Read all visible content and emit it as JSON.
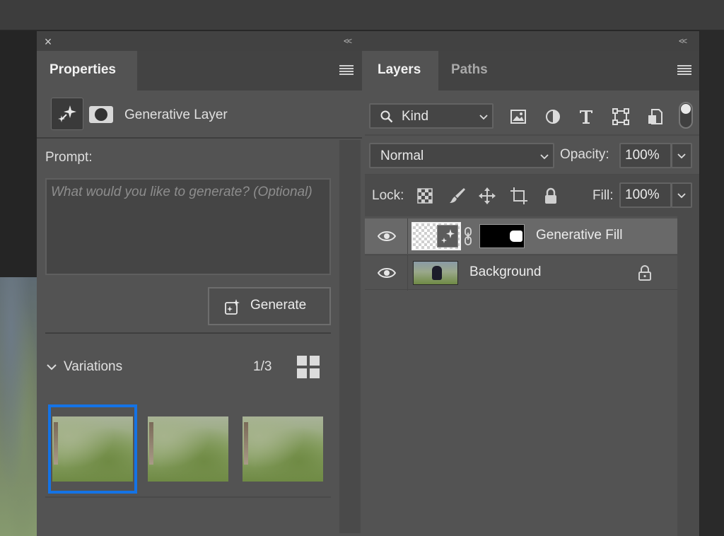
{
  "properties_panel": {
    "tab_label": "Properties",
    "layer_type_title": "Generative Layer",
    "prompt_label": "Prompt:",
    "prompt_placeholder": "What would you like to generate? (Optional)",
    "prompt_value": "",
    "generate_label": "Generate",
    "variations_label": "Variations",
    "variations_count": "1/3",
    "selected_variation": 1,
    "variation_count_total": 3
  },
  "layers_panel": {
    "tabs": [
      {
        "label": "Layers",
        "active": true
      },
      {
        "label": "Paths",
        "active": false
      }
    ],
    "filter_kind_label": "Kind",
    "blend_mode": "Normal",
    "opacity_label": "Opacity:",
    "opacity_value": "100%",
    "lock_label": "Lock:",
    "fill_label": "Fill:",
    "fill_value": "100%",
    "layers": [
      {
        "name": "Generative Fill",
        "selected": true,
        "visible": true,
        "locked": false
      },
      {
        "name": "Background",
        "selected": false,
        "visible": true,
        "locked": true
      }
    ]
  },
  "icons": {
    "close": "close-icon",
    "collapse": "collapse-icon",
    "panel_menu": "hamburger-icon",
    "generate": "sparkle-icon",
    "mask": "mask-icon",
    "search": "search-icon",
    "filter_pixel": "image-icon",
    "filter_adjustment": "half-circle-icon",
    "filter_type": "type-icon",
    "filter_shape": "shape-icon",
    "filter_smart": "smart-object-icon",
    "lock_pixels": "checkerboard-icon",
    "lock_paint": "brush-icon",
    "lock_position": "move-icon",
    "lock_artboard": "artboard-icon",
    "lock_all": "lock-icon",
    "visibility": "eye-icon",
    "grid": "grid-icon",
    "chain": "link-icon"
  },
  "colors": {
    "panel_bg": "#535353",
    "selection_accent": "#1473e6",
    "selected_layer_bg": "#696969"
  }
}
